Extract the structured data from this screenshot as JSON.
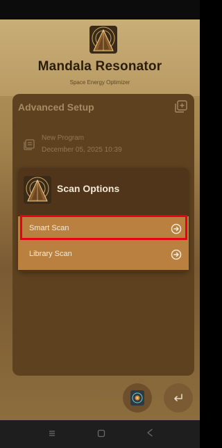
{
  "app": {
    "title": "Mandala Resonator",
    "subtitle": "Space Energy Optimizer"
  },
  "setup": {
    "title": "Advanced Setup",
    "program": {
      "name": "New Program",
      "date": "December 05, 2025 10:39"
    }
  },
  "dialog": {
    "title": "Scan Options",
    "options": [
      {
        "label": "Smart Scan",
        "highlighted": true
      },
      {
        "label": "Library Scan",
        "highlighted": false
      }
    ]
  },
  "icons": {
    "logo": "pyramid-mandala-logo-icon",
    "add": "add-square-icon",
    "program": "document-list-icon",
    "option_arrow": "circle-arrow-right-icon",
    "fab_scan": "mandala-scan-icon",
    "fab_back": "return-arrow-icon",
    "nav_menu": "menu-lines-icon",
    "nav_home": "square-home-icon",
    "nav_back": "triangle-back-icon"
  },
  "colors": {
    "highlight": "#e5001b",
    "option_bg": "#b9803f",
    "dialog_bg": "#50351a"
  }
}
